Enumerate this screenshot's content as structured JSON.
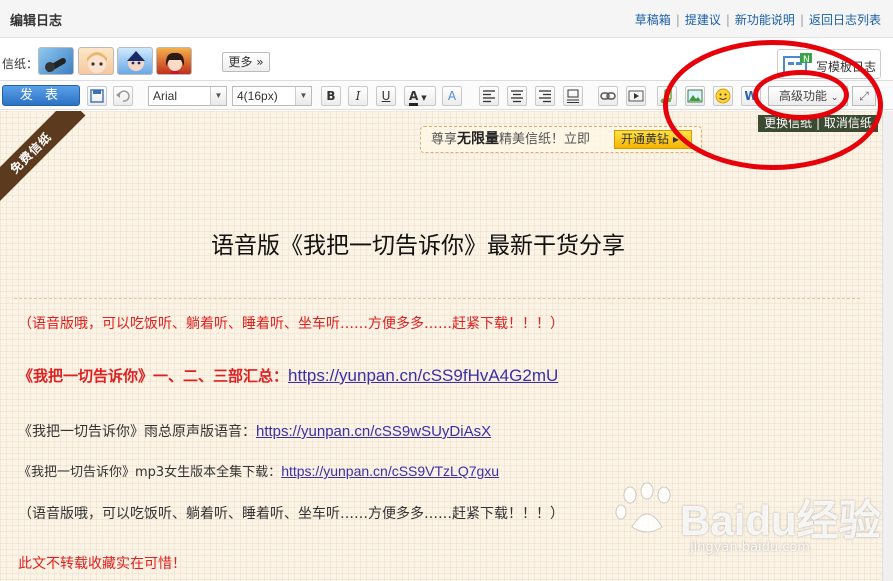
{
  "header": {
    "title": "编辑日志",
    "links": [
      "草稿箱",
      "提建议",
      "新功能说明",
      "返回日志列表"
    ]
  },
  "stationery": {
    "label": "信纸：",
    "more_label": "更多",
    "template_label": "写模板日志"
  },
  "toolbar": {
    "publish_label": "发 表",
    "font_family": "Arial",
    "font_size": "4(16px)",
    "advanced_label": "高级功能"
  },
  "editor": {
    "ribbon": "免费信纸",
    "promo": {
      "prefix": "尊享",
      "highlight": "无限量",
      "suffix": "精美信纸！立即",
      "button": "开通黄钻"
    },
    "swap_links": {
      "change": "更换信纸",
      "cancel": "取消信纸"
    },
    "title": "语音版《我把一切告诉你》最新干货分享",
    "lines": [
      {
        "text": "（语音版哦，可以吃饭听、躺着听、睡着听、坐车听……方便多多……赶紧下载！！！）"
      },
      {
        "text": "《我把一切告诉你》一、二、三部汇总：",
        "link": "https://yunpan.cn/cSS9fHvA4G2mU"
      },
      {
        "text": "《我把一切告诉你》雨总原声版语音：",
        "link": "https://yunpan.cn/cSS9wSUyDiAsX"
      },
      {
        "text": "《我把一切告诉你》mp3女生版本全集下载：",
        "link": "https://yunpan.cn/cSS9VTzLQ7gxu"
      },
      {
        "text": "（语音版哦，可以吃饭听、躺着听、睡着听、坐车听……方便多多……赶紧下载！！！）"
      },
      {
        "text": "此文不转载收藏实在可惜！"
      }
    ]
  },
  "watermark": {
    "brand": "Baidu经验",
    "url": "jingyan.baidu.com"
  },
  "colors": {
    "link_blue": "#1a5ea8",
    "publish_blue": "#2c72c4",
    "emphasis_red": "#e02020",
    "annotation_red": "#e6000a",
    "paper_bg": "#fbf3e5"
  }
}
